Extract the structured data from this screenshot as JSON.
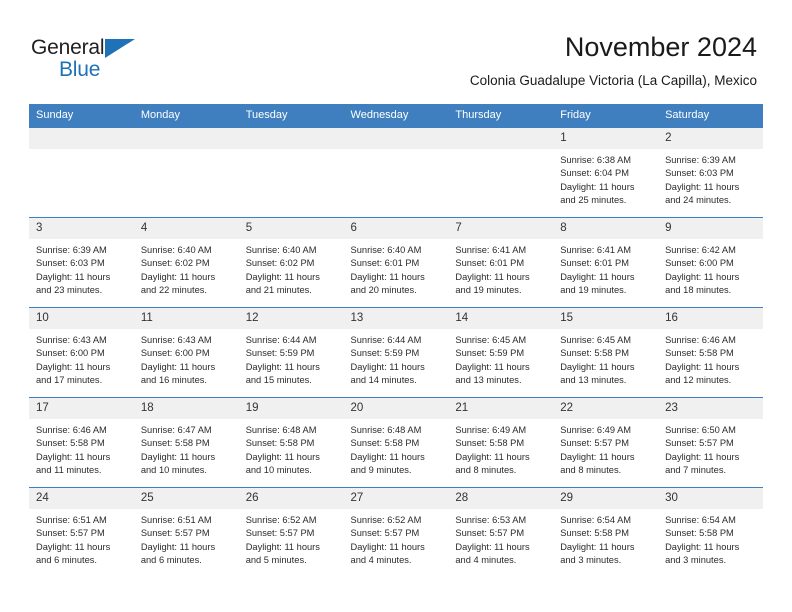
{
  "brand": {
    "name_part1": "General",
    "name_part2": "Blue",
    "accent_color": "#1f72b8"
  },
  "header": {
    "title": "November 2024",
    "subtitle": "Colonia Guadalupe Victoria (La Capilla), Mexico"
  },
  "theme": {
    "header_bar": "#3f7fbf",
    "daynum_band": "#f0f0f0",
    "text": "#2b2b2b"
  },
  "weekday_headers": [
    "Sunday",
    "Monday",
    "Tuesday",
    "Wednesday",
    "Thursday",
    "Friday",
    "Saturday"
  ],
  "weeks": [
    [
      {
        "day": "",
        "sunrise": "",
        "sunset": "",
        "daylight_line1": "",
        "daylight_line2": ""
      },
      {
        "day": "",
        "sunrise": "",
        "sunset": "",
        "daylight_line1": "",
        "daylight_line2": ""
      },
      {
        "day": "",
        "sunrise": "",
        "sunset": "",
        "daylight_line1": "",
        "daylight_line2": ""
      },
      {
        "day": "",
        "sunrise": "",
        "sunset": "",
        "daylight_line1": "",
        "daylight_line2": ""
      },
      {
        "day": "",
        "sunrise": "",
        "sunset": "",
        "daylight_line1": "",
        "daylight_line2": ""
      },
      {
        "day": "1",
        "sunrise": "Sunrise: 6:38 AM",
        "sunset": "Sunset: 6:04 PM",
        "daylight_line1": "Daylight: 11 hours",
        "daylight_line2": "and 25 minutes."
      },
      {
        "day": "2",
        "sunrise": "Sunrise: 6:39 AM",
        "sunset": "Sunset: 6:03 PM",
        "daylight_line1": "Daylight: 11 hours",
        "daylight_line2": "and 24 minutes."
      }
    ],
    [
      {
        "day": "3",
        "sunrise": "Sunrise: 6:39 AM",
        "sunset": "Sunset: 6:03 PM",
        "daylight_line1": "Daylight: 11 hours",
        "daylight_line2": "and 23 minutes."
      },
      {
        "day": "4",
        "sunrise": "Sunrise: 6:40 AM",
        "sunset": "Sunset: 6:02 PM",
        "daylight_line1": "Daylight: 11 hours",
        "daylight_line2": "and 22 minutes."
      },
      {
        "day": "5",
        "sunrise": "Sunrise: 6:40 AM",
        "sunset": "Sunset: 6:02 PM",
        "daylight_line1": "Daylight: 11 hours",
        "daylight_line2": "and 21 minutes."
      },
      {
        "day": "6",
        "sunrise": "Sunrise: 6:40 AM",
        "sunset": "Sunset: 6:01 PM",
        "daylight_line1": "Daylight: 11 hours",
        "daylight_line2": "and 20 minutes."
      },
      {
        "day": "7",
        "sunrise": "Sunrise: 6:41 AM",
        "sunset": "Sunset: 6:01 PM",
        "daylight_line1": "Daylight: 11 hours",
        "daylight_line2": "and 19 minutes."
      },
      {
        "day": "8",
        "sunrise": "Sunrise: 6:41 AM",
        "sunset": "Sunset: 6:01 PM",
        "daylight_line1": "Daylight: 11 hours",
        "daylight_line2": "and 19 minutes."
      },
      {
        "day": "9",
        "sunrise": "Sunrise: 6:42 AM",
        "sunset": "Sunset: 6:00 PM",
        "daylight_line1": "Daylight: 11 hours",
        "daylight_line2": "and 18 minutes."
      }
    ],
    [
      {
        "day": "10",
        "sunrise": "Sunrise: 6:43 AM",
        "sunset": "Sunset: 6:00 PM",
        "daylight_line1": "Daylight: 11 hours",
        "daylight_line2": "and 17 minutes."
      },
      {
        "day": "11",
        "sunrise": "Sunrise: 6:43 AM",
        "sunset": "Sunset: 6:00 PM",
        "daylight_line1": "Daylight: 11 hours",
        "daylight_line2": "and 16 minutes."
      },
      {
        "day": "12",
        "sunrise": "Sunrise: 6:44 AM",
        "sunset": "Sunset: 5:59 PM",
        "daylight_line1": "Daylight: 11 hours",
        "daylight_line2": "and 15 minutes."
      },
      {
        "day": "13",
        "sunrise": "Sunrise: 6:44 AM",
        "sunset": "Sunset: 5:59 PM",
        "daylight_line1": "Daylight: 11 hours",
        "daylight_line2": "and 14 minutes."
      },
      {
        "day": "14",
        "sunrise": "Sunrise: 6:45 AM",
        "sunset": "Sunset: 5:59 PM",
        "daylight_line1": "Daylight: 11 hours",
        "daylight_line2": "and 13 minutes."
      },
      {
        "day": "15",
        "sunrise": "Sunrise: 6:45 AM",
        "sunset": "Sunset: 5:58 PM",
        "daylight_line1": "Daylight: 11 hours",
        "daylight_line2": "and 13 minutes."
      },
      {
        "day": "16",
        "sunrise": "Sunrise: 6:46 AM",
        "sunset": "Sunset: 5:58 PM",
        "daylight_line1": "Daylight: 11 hours",
        "daylight_line2": "and 12 minutes."
      }
    ],
    [
      {
        "day": "17",
        "sunrise": "Sunrise: 6:46 AM",
        "sunset": "Sunset: 5:58 PM",
        "daylight_line1": "Daylight: 11 hours",
        "daylight_line2": "and 11 minutes."
      },
      {
        "day": "18",
        "sunrise": "Sunrise: 6:47 AM",
        "sunset": "Sunset: 5:58 PM",
        "daylight_line1": "Daylight: 11 hours",
        "daylight_line2": "and 10 minutes."
      },
      {
        "day": "19",
        "sunrise": "Sunrise: 6:48 AM",
        "sunset": "Sunset: 5:58 PM",
        "daylight_line1": "Daylight: 11 hours",
        "daylight_line2": "and 10 minutes."
      },
      {
        "day": "20",
        "sunrise": "Sunrise: 6:48 AM",
        "sunset": "Sunset: 5:58 PM",
        "daylight_line1": "Daylight: 11 hours",
        "daylight_line2": "and 9 minutes."
      },
      {
        "day": "21",
        "sunrise": "Sunrise: 6:49 AM",
        "sunset": "Sunset: 5:58 PM",
        "daylight_line1": "Daylight: 11 hours",
        "daylight_line2": "and 8 minutes."
      },
      {
        "day": "22",
        "sunrise": "Sunrise: 6:49 AM",
        "sunset": "Sunset: 5:57 PM",
        "daylight_line1": "Daylight: 11 hours",
        "daylight_line2": "and 8 minutes."
      },
      {
        "day": "23",
        "sunrise": "Sunrise: 6:50 AM",
        "sunset": "Sunset: 5:57 PM",
        "daylight_line1": "Daylight: 11 hours",
        "daylight_line2": "and 7 minutes."
      }
    ],
    [
      {
        "day": "24",
        "sunrise": "Sunrise: 6:51 AM",
        "sunset": "Sunset: 5:57 PM",
        "daylight_line1": "Daylight: 11 hours",
        "daylight_line2": "and 6 minutes."
      },
      {
        "day": "25",
        "sunrise": "Sunrise: 6:51 AM",
        "sunset": "Sunset: 5:57 PM",
        "daylight_line1": "Daylight: 11 hours",
        "daylight_line2": "and 6 minutes."
      },
      {
        "day": "26",
        "sunrise": "Sunrise: 6:52 AM",
        "sunset": "Sunset: 5:57 PM",
        "daylight_line1": "Daylight: 11 hours",
        "daylight_line2": "and 5 minutes."
      },
      {
        "day": "27",
        "sunrise": "Sunrise: 6:52 AM",
        "sunset": "Sunset: 5:57 PM",
        "daylight_line1": "Daylight: 11 hours",
        "daylight_line2": "and 4 minutes."
      },
      {
        "day": "28",
        "sunrise": "Sunrise: 6:53 AM",
        "sunset": "Sunset: 5:57 PM",
        "daylight_line1": "Daylight: 11 hours",
        "daylight_line2": "and 4 minutes."
      },
      {
        "day": "29",
        "sunrise": "Sunrise: 6:54 AM",
        "sunset": "Sunset: 5:58 PM",
        "daylight_line1": "Daylight: 11 hours",
        "daylight_line2": "and 3 minutes."
      },
      {
        "day": "30",
        "sunrise": "Sunrise: 6:54 AM",
        "sunset": "Sunset: 5:58 PM",
        "daylight_line1": "Daylight: 11 hours",
        "daylight_line2": "and 3 minutes."
      }
    ]
  ]
}
